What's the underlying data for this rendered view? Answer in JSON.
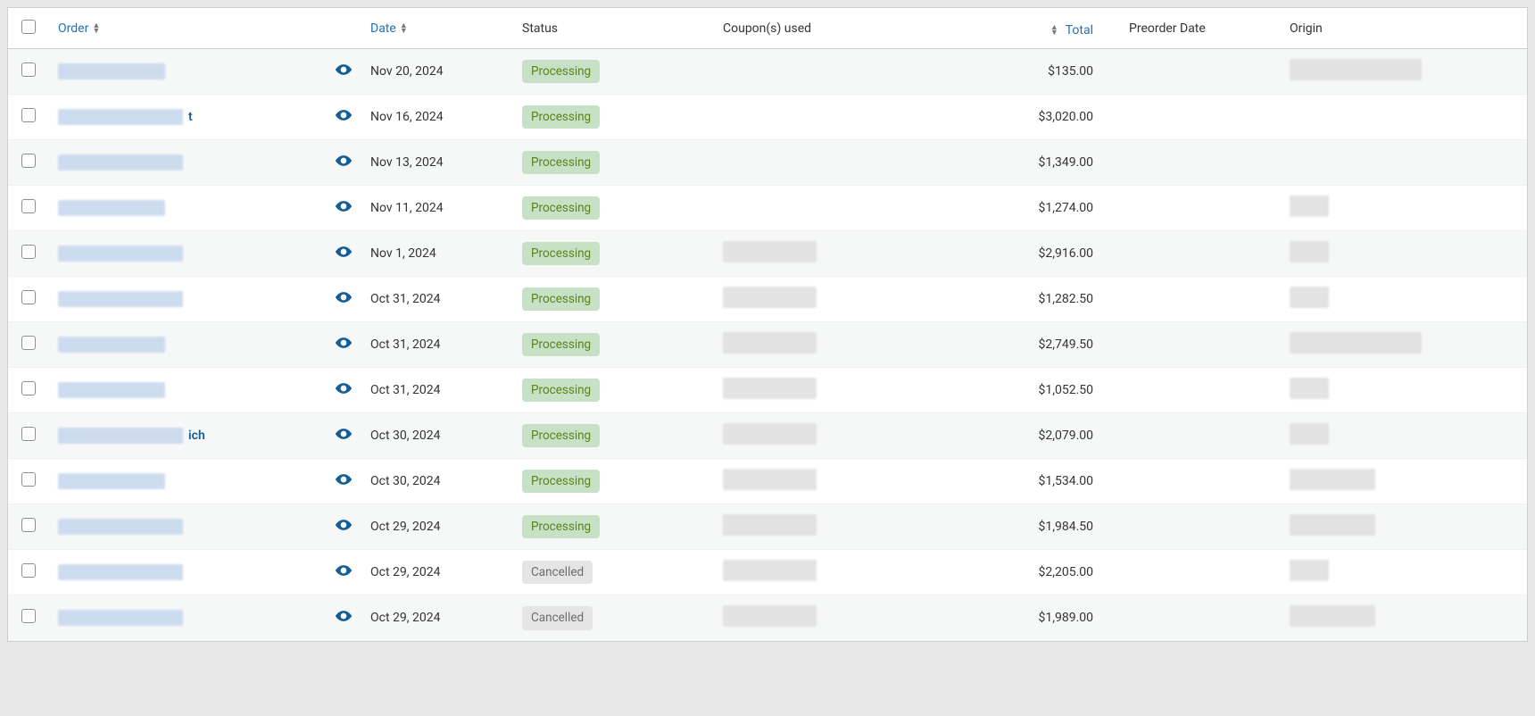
{
  "columns": {
    "order": "Order",
    "date": "Date",
    "status": "Status",
    "coupons": "Coupon(s) used",
    "total": "Total",
    "preorder": "Preorder Date",
    "origin": "Origin"
  },
  "status_labels": {
    "processing": "Processing",
    "cancelled": "Cancelled"
  },
  "rows": [
    {
      "date": "Nov 20, 2024",
      "status": "processing",
      "total": "$135.00",
      "order_redact_w": 120,
      "order_extra": "",
      "coupon": false,
      "origin_w": 148
    },
    {
      "date": "Nov 16, 2024",
      "status": "processing",
      "total": "$3,020.00",
      "order_redact_w": 140,
      "order_extra": "t",
      "coupon": false,
      "origin_w": 0
    },
    {
      "date": "Nov 13, 2024",
      "status": "processing",
      "total": "$1,349.00",
      "order_redact_w": 140,
      "order_extra": "",
      "coupon": false,
      "origin_w": 0
    },
    {
      "date": "Nov 11, 2024",
      "status": "processing",
      "total": "$1,274.00",
      "order_redact_w": 120,
      "order_extra": "",
      "coupon": false,
      "origin_w": 44
    },
    {
      "date": "Nov 1, 2024",
      "status": "processing",
      "total": "$2,916.00",
      "order_redact_w": 140,
      "order_extra": "",
      "coupon": true,
      "origin_w": 44
    },
    {
      "date": "Oct 31, 2024",
      "status": "processing",
      "total": "$1,282.50",
      "order_redact_w": 140,
      "order_extra": "",
      "coupon": true,
      "origin_w": 44
    },
    {
      "date": "Oct 31, 2024",
      "status": "processing",
      "total": "$2,749.50",
      "order_redact_w": 120,
      "order_extra": "",
      "coupon": true,
      "origin_w": 148
    },
    {
      "date": "Oct 31, 2024",
      "status": "processing",
      "total": "$1,052.50",
      "order_redact_w": 120,
      "order_extra": "",
      "coupon": true,
      "origin_w": 44
    },
    {
      "date": "Oct 30, 2024",
      "status": "processing",
      "total": "$2,079.00",
      "order_redact_w": 140,
      "order_extra": "ich",
      "coupon": true,
      "origin_w": 44
    },
    {
      "date": "Oct 30, 2024",
      "status": "processing",
      "total": "$1,534.00",
      "order_redact_w": 120,
      "order_extra": "",
      "coupon": true,
      "origin_w": 96
    },
    {
      "date": "Oct 29, 2024",
      "status": "processing",
      "total": "$1,984.50",
      "order_redact_w": 140,
      "order_extra": "",
      "coupon": true,
      "origin_w": 96
    },
    {
      "date": "Oct 29, 2024",
      "status": "cancelled",
      "total": "$2,205.00",
      "order_redact_w": 140,
      "order_extra": "",
      "coupon": true,
      "origin_w": 44
    },
    {
      "date": "Oct 29, 2024",
      "status": "cancelled",
      "total": "$1,989.00",
      "order_redact_w": 140,
      "order_extra": "",
      "coupon": true,
      "origin_w": 96
    }
  ]
}
